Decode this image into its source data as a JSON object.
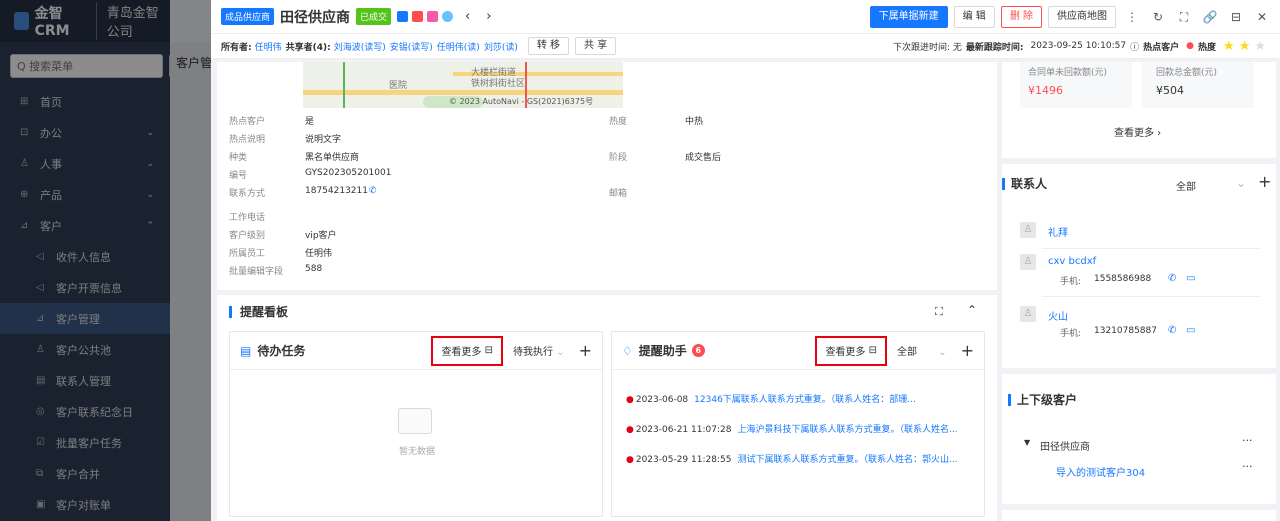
{
  "app": {
    "brand": "金智CRM",
    "company": "青岛金智公司"
  },
  "sidebar": {
    "search_placeholder": "Q 搜索菜单",
    "plus": "+",
    "items": [
      {
        "icon": "⊞",
        "label": "首页"
      },
      {
        "icon": "⊡",
        "label": "办公",
        "arrow": "⌄"
      },
      {
        "icon": "♙",
        "label": "人事",
        "arrow": "⌄"
      },
      {
        "icon": "⊕",
        "label": "产品",
        "arrow": "⌄"
      },
      {
        "icon": "⊿",
        "label": "客户",
        "arrow": "⌃"
      },
      {
        "icon": "◁",
        "label": "收件人信息"
      },
      {
        "icon": "◁",
        "label": "客户开票信息"
      },
      {
        "icon": "⊿",
        "label": "客户管理"
      },
      {
        "icon": "♙",
        "label": "客户公共池"
      },
      {
        "icon": "▤",
        "label": "联系人管理"
      },
      {
        "icon": "◎",
        "label": "客户联系纪念日"
      },
      {
        "icon": "☑",
        "label": "批量客户任务"
      },
      {
        "icon": "⧉",
        "label": "客户合并"
      },
      {
        "icon": "▣",
        "label": "客户对账单"
      }
    ]
  },
  "bg_tab": "客户管",
  "header": {
    "type_tag": "成品供应商",
    "title": "田径供应商",
    "status_tag": "已成交",
    "prev": "‹",
    "next": "›",
    "buttons": {
      "new_sub": "下属单据新建",
      "edit": "编 辑",
      "delete": "删 除",
      "map": "供应商地图"
    },
    "icons": [
      "⋮",
      "↻",
      "⛶",
      "🔗",
      "⊟",
      "✕"
    ]
  },
  "subheader": {
    "owner_label": "所有者:",
    "owner": "任明伟",
    "share_label": "共享者(4):",
    "sharers": [
      "刘海波(读写)",
      "安锡(读写)",
      "任明伟(读)",
      "刘莎(读)"
    ],
    "transfer": "转 移",
    "share": "共 享",
    "next_follow": "下次跟进时间: 无",
    "last_follow_label": "最新跟踪时间:",
    "last_follow": "2023-09-25 10:10:57",
    "hot_label": "热点客户",
    "heat_label": "热度"
  },
  "map": {
    "poi": "医院",
    "street": "大楼栏街道",
    "community": "铁树斜街社区",
    "copyright": "© 2023 AutoNavi - GS(2021)6375号"
  },
  "fields": [
    {
      "label": "热点客户",
      "value": "是"
    },
    {
      "label": "热点说明",
      "value": "说明文字"
    },
    {
      "label": "种类",
      "value": "黑名单供应商"
    },
    {
      "label": "编号",
      "value": "GYS202305201001"
    },
    {
      "label": "联系方式",
      "value": "18754213211"
    },
    {
      "label": "工作电话",
      "value": ""
    },
    {
      "label": "客户级别",
      "value": "vip客户"
    },
    {
      "label": "所属员工",
      "value": "任明伟"
    },
    {
      "label": "批量编辑字段",
      "value": "588"
    }
  ],
  "fields_right": [
    {
      "label": "热度",
      "value": "中热"
    },
    {
      "label": "阶段",
      "value": "成交售后"
    },
    {
      "label": "邮箱",
      "value": ""
    }
  ],
  "board": {
    "title": "提醒看板",
    "todo": {
      "title": "待办任务",
      "more": "查看更多",
      "filter": "待我执行",
      "empty": "暂无数据"
    },
    "reminder": {
      "title": "提醒助手",
      "count": "6",
      "more": "查看更多",
      "filter": "全部",
      "rows": [
        {
          "date": "2023-06-08",
          "text": "12346下属联系人联系方式重复。（联系人姓名：部珊..."
        },
        {
          "date": "2023-06-21 11:07:28",
          "text": "上海沪景科技下属联系人联系方式重复。（联系人姓名..."
        },
        {
          "date": "2023-05-29 11:28:55",
          "text": "测试下属联系人联系方式重复。（联系人姓名：郭火山..."
        }
      ]
    }
  },
  "summary": {
    "unpaid_label": "合同单未回款额(元)",
    "unpaid_value": "¥1496",
    "paid_label": "回款总金额(元)",
    "paid_value": "¥504",
    "more": "查看更多 ›"
  },
  "contacts": {
    "title": "联系人",
    "filter": "全部",
    "items": [
      {
        "name": "礼拜",
        "phone_label": "",
        "phone": ""
      },
      {
        "name": "cxv bcdxf",
        "phone_label": "手机:",
        "phone": "1558586988"
      },
      {
        "name": "火山",
        "phone_label": "手机:",
        "phone": "13210785887"
      }
    ]
  },
  "hierarchy": {
    "title": "上下级客户",
    "parent": "田径供应商",
    "child": "导入的测试客户304",
    "dots": "···"
  },
  "colors": {
    "primary": "#1677ff",
    "danger": "#ff4d4f",
    "highlight_box": "#e60012"
  }
}
